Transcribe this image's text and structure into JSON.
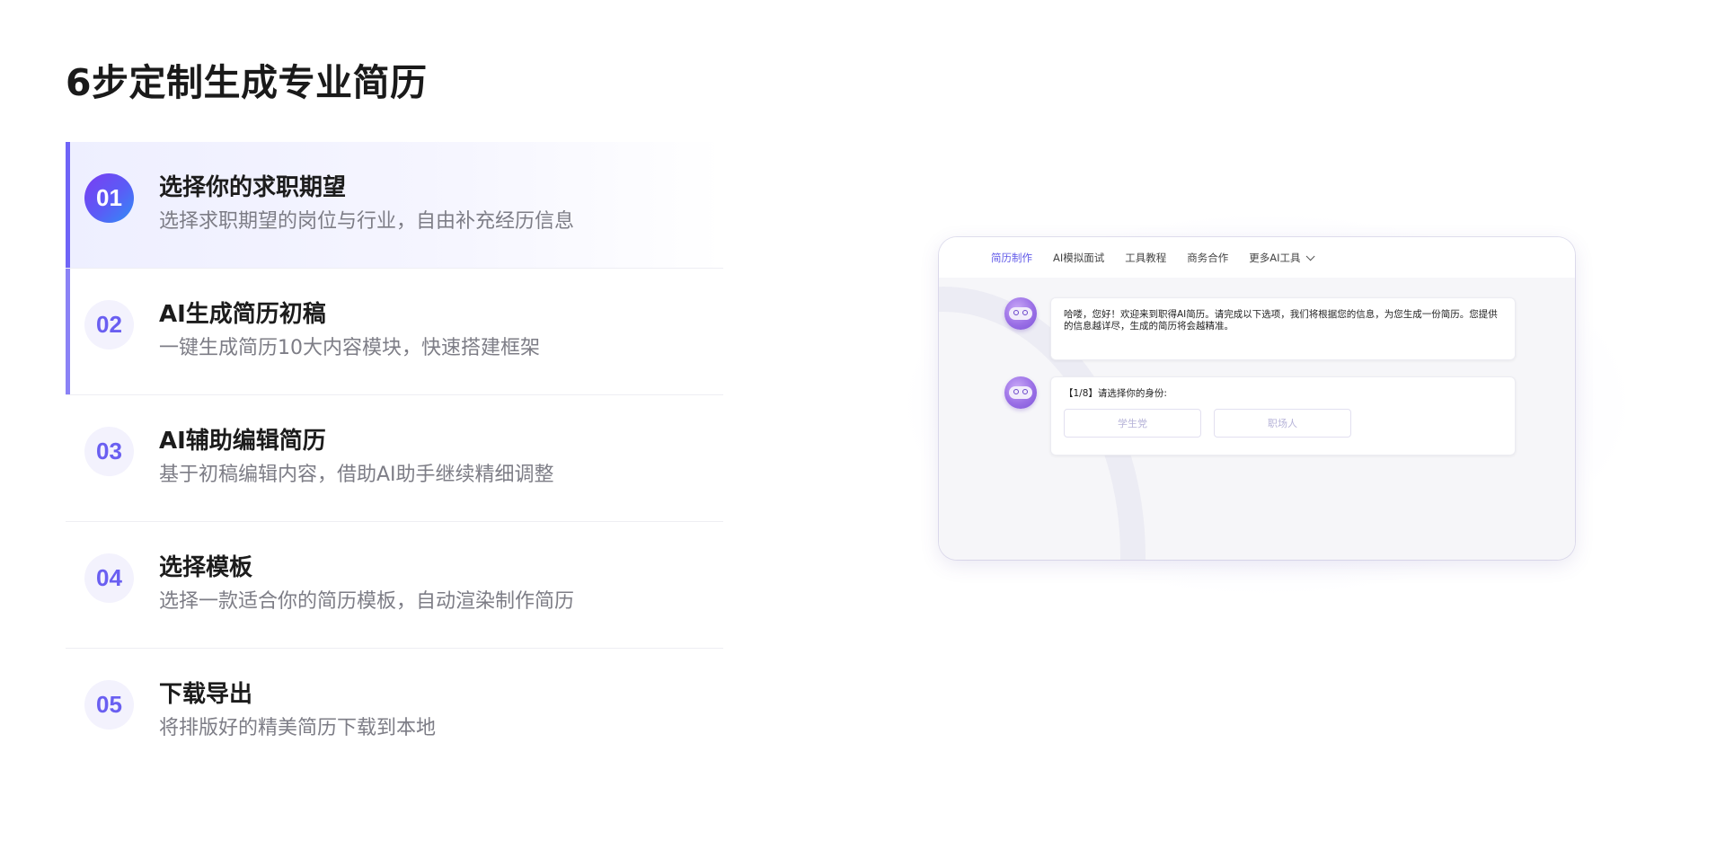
{
  "title": "6步定制生成专业简历",
  "steps": [
    {
      "num": "01",
      "title": "选择你的求职期望",
      "desc": "选择求职期望的岗位与行业，自由补充经历信息"
    },
    {
      "num": "02",
      "title": "AI生成简历初稿",
      "desc": "一键生成简历10大内容模块，快速搭建框架"
    },
    {
      "num": "03",
      "title": "AI辅助编辑简历",
      "desc": "基于初稿编辑内容，借助AI助手继续精细调整"
    },
    {
      "num": "04",
      "title": "选择模板",
      "desc": "选择一款适合你的简历模板，自动渲染制作简历"
    },
    {
      "num": "05",
      "title": "下载导出",
      "desc": "将排版好的精美简历下载到本地"
    }
  ],
  "preview": {
    "nav": [
      "简历制作",
      "AI模拟面试",
      "工具教程",
      "商务合作",
      "更多AI工具"
    ],
    "messages": [
      {
        "text": "哈喽，您好！欢迎来到职得AI简历。请完成以下选项，我们将根据您的信息，为您生成一份简历。您提供的信息越详尽，生成的简历将会越精准。"
      },
      {
        "text": "【1/8】请选择你的身份:",
        "options": [
          "学生党",
          "职场人"
        ]
      }
    ]
  },
  "colors": {
    "accent": "#6f64f7",
    "number_text": "#6a5ff1",
    "nav_active": "#5f58e8"
  }
}
